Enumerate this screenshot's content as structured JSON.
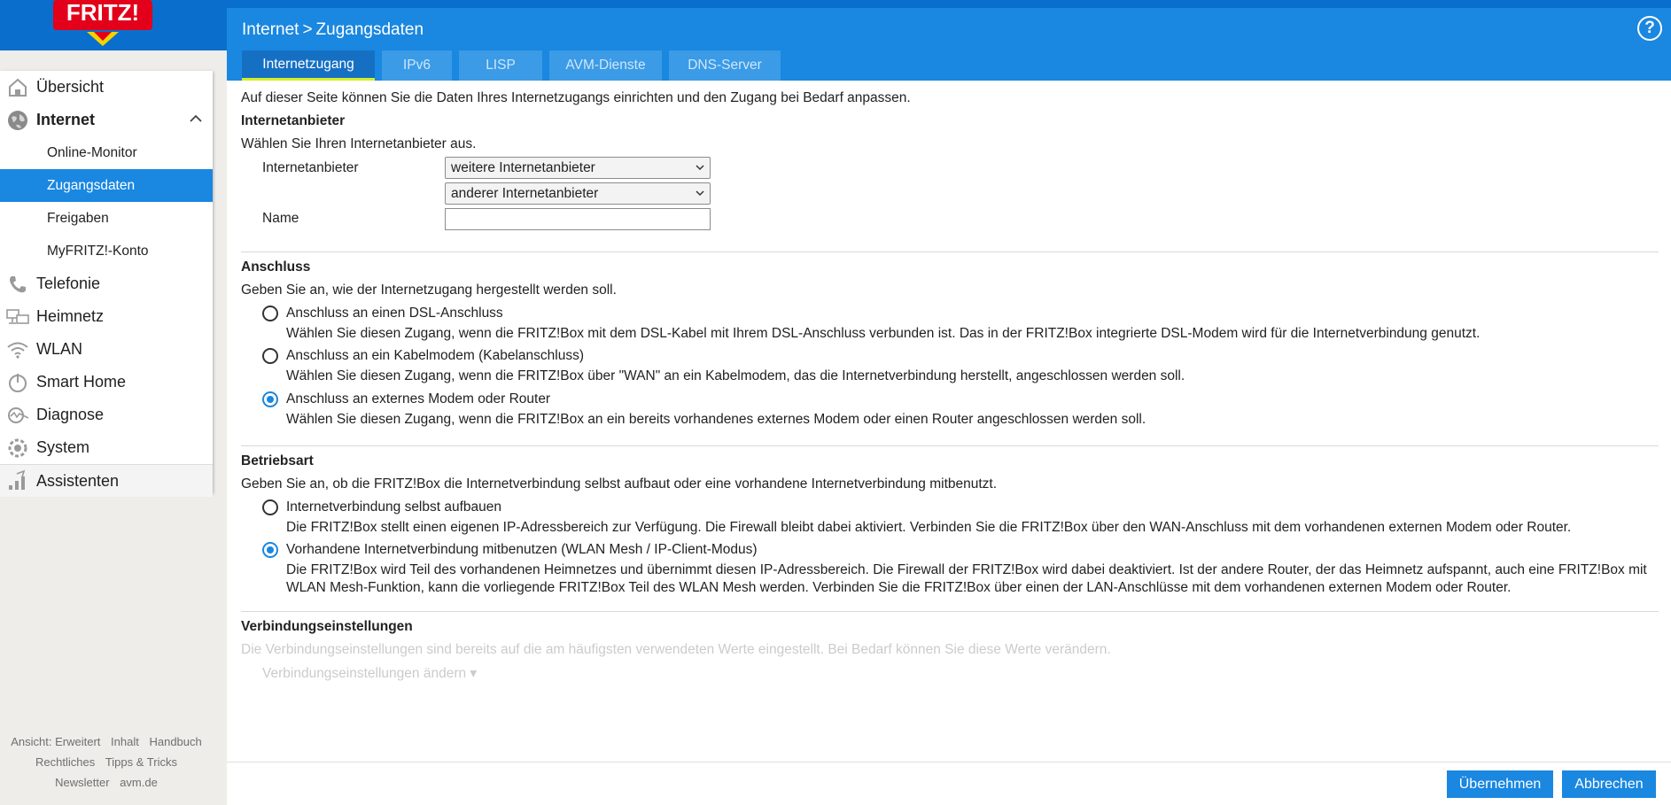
{
  "logo_text": "FRITZ!",
  "breadcrumb": {
    "section": "Internet",
    "separator": ">",
    "page": "Zugangsdaten"
  },
  "help_label": "?",
  "tabs": [
    {
      "label": "Internetzugang",
      "active": true
    },
    {
      "label": "IPv6"
    },
    {
      "label": "LISP"
    },
    {
      "label": "AVM-Dienste"
    },
    {
      "label": "DNS-Server"
    }
  ],
  "sidebar": {
    "items": [
      {
        "label": "Übersicht",
        "icon": "home-icon"
      },
      {
        "label": "Internet",
        "icon": "globe-icon",
        "expanded": true
      },
      {
        "label": "Online-Monitor"
      },
      {
        "label": "Zugangsdaten",
        "active": true
      },
      {
        "label": "Freigaben"
      },
      {
        "label": "MyFRITZ!-Konto"
      },
      {
        "label": "Telefonie",
        "icon": "phone-icon"
      },
      {
        "label": "Heimnetz",
        "icon": "network-icon"
      },
      {
        "label": "WLAN",
        "icon": "wifi-icon"
      },
      {
        "label": "Smart Home",
        "icon": "smart-home-icon"
      },
      {
        "label": "Diagnose",
        "icon": "diagnose-icon"
      },
      {
        "label": "System",
        "icon": "system-icon"
      },
      {
        "label": "Assistenten",
        "icon": "assistant-icon"
      }
    ],
    "footer": {
      "row1": [
        "Ansicht: Erweitert",
        "Inhalt",
        "Handbuch"
      ],
      "row2": [
        "Rechtliches",
        "Tipps & Tricks"
      ],
      "row3": [
        "Newsletter",
        "avm.de"
      ]
    }
  },
  "intro": "Auf dieser Seite können Sie die Daten Ihres Internetzugangs einrichten und den Zugang bei Bedarf anpassen.",
  "provider": {
    "heading": "Internetanbieter",
    "hint": "Wählen Sie Ihren Internetanbieter aus.",
    "provider_label": "Internetanbieter",
    "select1": "weitere Internetanbieter",
    "select2": "anderer Internetanbieter",
    "name_label": "Name",
    "name_value": ""
  },
  "connection": {
    "heading": "Anschluss",
    "hint": "Geben Sie an, wie der Internetzugang hergestellt werden soll.",
    "options": [
      {
        "label": "Anschluss an einen DSL-Anschluss",
        "desc": "Wählen Sie diesen Zugang, wenn die FRITZ!Box mit dem DSL-Kabel mit Ihrem DSL-Anschluss verbunden ist. Das in der FRITZ!Box integrierte DSL-Modem wird für die Internetverbindung genutzt.",
        "checked": false
      },
      {
        "label": "Anschluss an ein Kabelmodem (Kabelanschluss)",
        "desc": "Wählen Sie diesen Zugang, wenn die FRITZ!Box über \"WAN\" an ein Kabelmodem, das die Internetverbindung herstellt, angeschlossen werden soll.",
        "checked": false
      },
      {
        "label": "Anschluss an externes Modem oder Router",
        "desc": "Wählen Sie diesen Zugang, wenn die FRITZ!Box an ein bereits vorhandenes externes Modem oder einen Router angeschlossen werden soll.",
        "checked": true
      }
    ]
  },
  "mode": {
    "heading": "Betriebsart",
    "hint": "Geben Sie an, ob die FRITZ!Box die Internetverbindung selbst aufbaut oder eine vorhandene Internetverbindung mitbenutzt.",
    "options": [
      {
        "label": "Internetverbindung selbst aufbauen",
        "desc": "Die FRITZ!Box stellt einen eigenen IP-Adressbereich zur Verfügung. Die Firewall bleibt dabei aktiviert. Verbinden Sie die FRITZ!Box über den WAN-Anschluss mit dem vorhandenen externen Modem oder Router.",
        "checked": false
      },
      {
        "label": "Vorhandene Internetverbindung mitbenutzen (WLAN Mesh / IP-Client-Modus)",
        "desc": "Die FRITZ!Box wird Teil des vorhandenen Heimnetzes und übernimmt diesen IP-Adressbereich. Die Firewall der FRITZ!Box wird dabei deaktiviert. Ist der andere Router, der das Heimnetz aufspannt, auch eine FRITZ!Box mit WLAN Mesh-Funktion, kann die vorliegende FRITZ!Box Teil des WLAN Mesh werden. Verbinden Sie die FRITZ!Box über einen der LAN-Anschlüsse mit dem vorhandenen externen Modem oder Router.",
        "checked": true
      }
    ]
  },
  "settings": {
    "heading": "Verbindungseinstellungen",
    "hint": "Die Verbindungseinstellungen sind bereits auf die am häufigsten verwendeten Werte eingestellt. Bei Bedarf können Sie diese Werte verändern.",
    "link": "Verbindungseinstellungen ändern ▾"
  },
  "buttons": {
    "apply": "Übernehmen",
    "cancel": "Abbrechen"
  },
  "colors": {
    "primary": "#1a87e0",
    "topbar": "#0a6fcc",
    "tab_underline": "#d6ee27"
  }
}
